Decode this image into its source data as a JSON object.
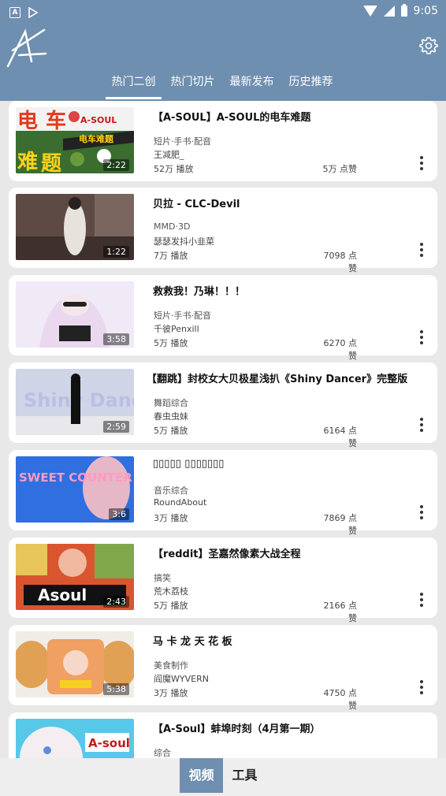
{
  "status_bar": {
    "time": "9:05",
    "left_icons": [
      "A",
      "play-store"
    ]
  },
  "header": {
    "tabs": [
      {
        "label": "热门二创",
        "active": true
      },
      {
        "label": "热门切片",
        "active": false
      },
      {
        "label": "最新发布",
        "active": false
      },
      {
        "label": "历史推荐",
        "active": false
      }
    ],
    "accent_color": "#6f8fb0"
  },
  "videos": [
    {
      "title": "【A-SOUL】A-SOUL的电车难题",
      "category": "短片·手书·配音",
      "author": "王减肥_",
      "plays": "52万 播放",
      "likes": "5万 点赞",
      "duration": "2:22"
    },
    {
      "title": "贝拉 - CLC-Devil",
      "category": "MMD·3D",
      "author": "瑟瑟发抖小韭菜",
      "plays": "7万 播放",
      "likes": "7098 点赞",
      "duration": "1:22"
    },
    {
      "title": "救救我！乃琳！！！",
      "category": "短片·手书·配音",
      "author": "千彼Penxill",
      "plays": "5万 播放",
      "likes": "6270 点赞",
      "duration": "3:58"
    },
    {
      "title": "【翻跳】封校女大贝极星浅扒《Shiny Dancer》完整版",
      "category": "舞蹈综合",
      "author": "春虫虫妹",
      "plays": "5万 播放",
      "likes": "6164 点赞",
      "duration": "2:59"
    },
    {
      "title": "▯▯▯▯▯ ▯▯▯▯▯▯▯",
      "category": "音乐综合",
      "author": "RoundAbout",
      "plays": "3万 播放",
      "likes": "7869 点赞",
      "duration": "3:6"
    },
    {
      "title": "【reddit】圣嘉然像素大战全程",
      "category": "搞笑",
      "author": "荒木荔枝",
      "plays": "5万 播放",
      "likes": "2166 点赞",
      "duration": "2:43"
    },
    {
      "title": "马 卡 龙 天 花 板",
      "category": "美食制作",
      "author": "阎魔WYVERN",
      "plays": "3万 播放",
      "likes": "4750 点赞",
      "duration": "5:38"
    },
    {
      "title": "【A-Soul】蚌埠时刻（4月第一期）",
      "category": "综合",
      "author": "",
      "plays": "",
      "likes": "",
      "duration": ""
    }
  ],
  "thumb_text": {
    "t1_a": "电",
    "t1_b": "车",
    "t1_c": "难",
    "t1_d": "题",
    "t1_logo": "A-SOUL",
    "t1_sub": "电车难题",
    "t4": "Shiny Dancer",
    "t5": "SWEET COUNTER",
    "t6": "Asoul",
    "t8": "A-soul"
  },
  "bottom_nav": [
    {
      "label": "视频",
      "active": true
    },
    {
      "label": "工具",
      "active": false
    }
  ]
}
